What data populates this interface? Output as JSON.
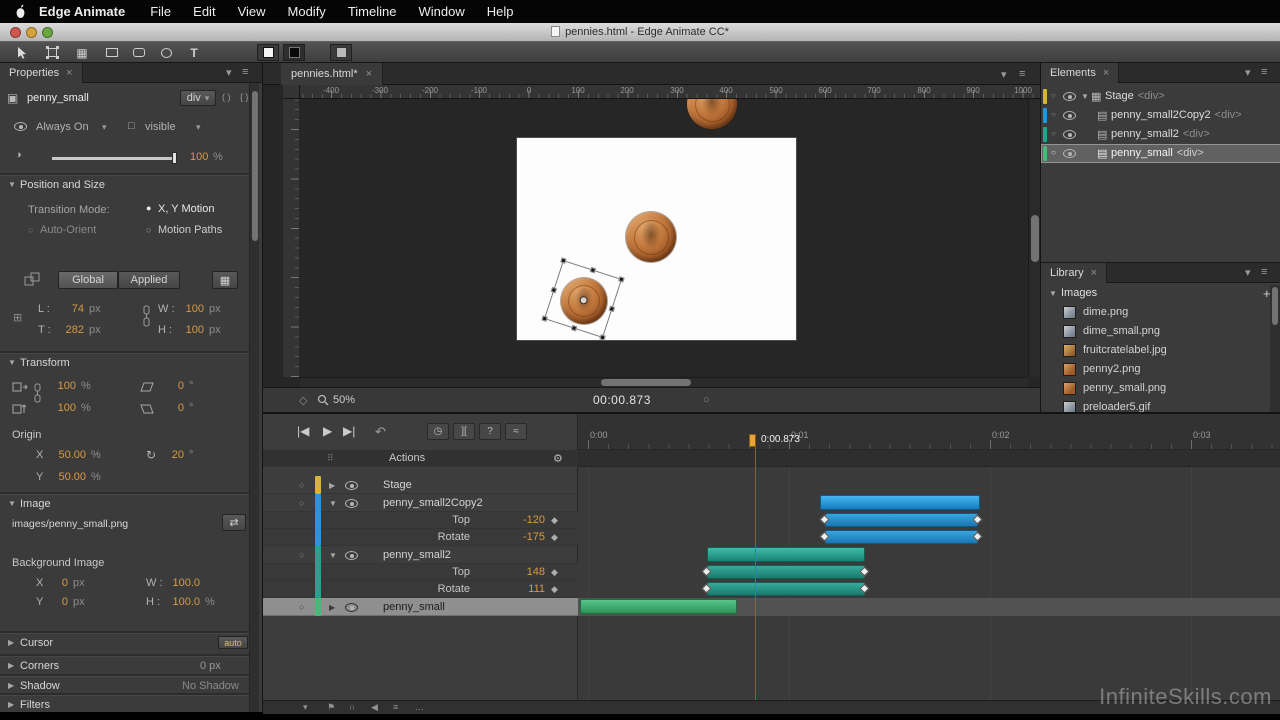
{
  "icons": {
    "close": "×",
    "chevron_down": "▾",
    "menu": "≡",
    "plus": "+",
    "gear": "⚙",
    "keyframe_diamond": "◆",
    "tri_down": "▼",
    "tri_right": "▶",
    "radio_on": "●",
    "radio_off": "○",
    "layer_dot": "○",
    "skip_back": "|◀",
    "play": "▶",
    "skip_fwd": "▶|",
    "undo": "↶",
    "question": "?",
    "pin_bracket": "][",
    "easing_curve": "≈",
    "stopwatch": "◷",
    "flag": "⚑",
    "magnet": "∩",
    "audio": "◀",
    "list": "≡",
    "ellipsis": "…",
    "swap": "⇄",
    "rotate_cw": "↻",
    "grid_btn": "▦",
    "stage_icon": "▦",
    "div_icon": "▤",
    "element_icon": "▣",
    "visible_box": "□",
    "opacity_circle": "◑",
    "anchor": "⊞",
    "braces": "{ }",
    "parens": "( )",
    "grip": "⠿",
    "pan": "◇",
    "loop_circle": "○",
    "text_tool": "T",
    "dot": "●"
  },
  "menubar": {
    "app_name": "Edge Animate",
    "items": [
      "File",
      "Edit",
      "View",
      "Modify",
      "Timeline",
      "Window",
      "Help"
    ]
  },
  "titlebar": {
    "title": "pennies.html - Edge Animate CC*"
  },
  "properties": {
    "title": "Properties",
    "element_name": "penny_small",
    "tag": "div",
    "always_on": "Always On",
    "visible": "visible",
    "opacity_value": "100",
    "opacity_unit": "%",
    "position_size": {
      "title": "Position and Size",
      "transition_mode_label": "Transition Mode:",
      "xy_motion": "X, Y Motion",
      "auto_orient": "Auto-Orient",
      "motion_paths": "Motion Paths",
      "global_btn": "Global",
      "applied_btn": "Applied",
      "l_label": "L :",
      "l_value": "74",
      "l_unit": "px",
      "t_label": "T :",
      "t_value": "282",
      "t_unit": "px",
      "w_label": "W :",
      "w_value": "100",
      "w_unit": "px",
      "h_label": "H :",
      "h_value": "100",
      "h_unit": "px"
    },
    "transform": {
      "title": "Transform",
      "scale_x_value": "100",
      "scale_x_unit": "%",
      "scale_y_value": "100",
      "scale_y_unit": "%",
      "skew_x_value": "0",
      "skew_x_unit": "°",
      "skew_y_value": "0",
      "skew_y_unit": "°",
      "origin_label": "Origin",
      "x_label": "X",
      "x_value": "50.00",
      "x_unit": "%",
      "y_label": "Y",
      "y_value": "50.00",
      "y_unit": "%",
      "rotate_value": "20",
      "rotate_unit": "°"
    },
    "image": {
      "title": "Image",
      "src": "images/penny_small.png",
      "background_label": "Background Image",
      "x_label": "X",
      "x_value": "0",
      "x_unit": "px",
      "y_label": "Y",
      "y_value": "0",
      "y_unit": "px",
      "w_label": "W :",
      "w_value": "100.0",
      "h_label": "H :",
      "h_value": "100.0",
      "h_unit": "%"
    },
    "cursor": {
      "title": "Cursor",
      "button": "auto"
    },
    "corners": {
      "title": "Corners",
      "value": "0 px"
    },
    "shadow": {
      "title": "Shadow",
      "value": "No Shadow"
    },
    "filters": {
      "title": "Filters"
    }
  },
  "stage": {
    "tab": "pennies.html*",
    "zoom": "50%",
    "time": "00:00.873",
    "ruler_labels": [
      "-400",
      "-300",
      "-200",
      "-100",
      "0",
      "100",
      "200",
      "300",
      "400",
      "500",
      "600",
      "700",
      "800",
      "900",
      "1000"
    ]
  },
  "elements": {
    "title": "Elements",
    "rows": [
      {
        "label": "Stage",
        "tag": "<div>",
        "color": "#d8b33c"
      },
      {
        "label": "penny_small2Copy2",
        "tag": "<div>",
        "color": "#2398d8"
      },
      {
        "label": "penny_small2",
        "tag": "<div>",
        "color": "#2aa08e"
      },
      {
        "label": "penny_small",
        "tag": "<div>",
        "color": "#4cb878"
      }
    ]
  },
  "library": {
    "title": "Library",
    "section": "Images",
    "items": [
      "dime.png",
      "dime_small.png",
      "fruitcratelabel.jpg",
      "penny2.png",
      "penny_small.png",
      "preloader5.gif"
    ]
  },
  "timeline": {
    "actions_label": "Actions",
    "playhead_time": "0:00.873",
    "ruler_labels": [
      "0:00",
      "0:01",
      "0:02",
      "0:03"
    ],
    "rows": {
      "stage": {
        "label": "Stage",
        "color": "#d8b33c"
      },
      "pc2": {
        "label": "penny_small2Copy2",
        "color": "#2398d8",
        "top_label": "Top",
        "top_value": "-120",
        "rotate_label": "Rotate",
        "rotate_value": "-175"
      },
      "ps2": {
        "label": "penny_small2",
        "color": "#2aa08e",
        "top_label": "Top",
        "top_value": "148",
        "rotate_label": "Rotate",
        "rotate_value": "111"
      },
      "ps": {
        "label": "penny_small",
        "color": "#4cb878"
      }
    },
    "bar_colors": {
      "blue": "#1f9ddd",
      "teal": "#2aa08e",
      "green": "#4cb878"
    }
  },
  "watermark": "InfiniteSkills.com",
  "colors": {
    "accent_orange": "#d89a43"
  }
}
